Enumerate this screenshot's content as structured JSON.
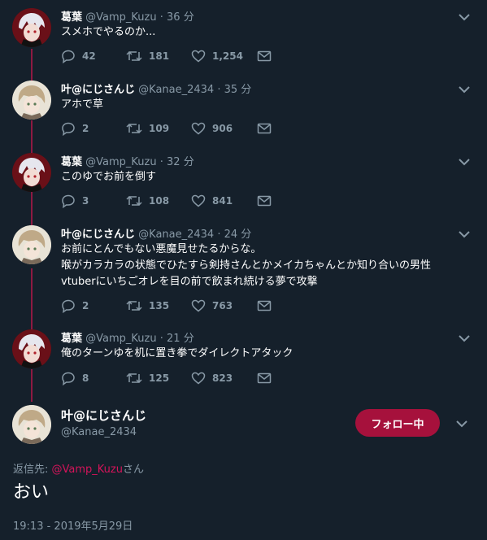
{
  "thread": [
    {
      "name": "葛葉",
      "handle": "@Vamp_Kuzu",
      "time": "36 分",
      "lines": [
        "スメホでやるのか..."
      ],
      "replies": "42",
      "retweets": "181",
      "likes": "1,254",
      "avatar": "kuzuha"
    },
    {
      "name": "叶@にじさんじ",
      "handle": "@Kanae_2434",
      "time": "35 分",
      "lines": [
        "アホで草"
      ],
      "replies": "2",
      "retweets": "109",
      "likes": "906",
      "avatar": "kanae"
    },
    {
      "name": "葛葉",
      "handle": "@Vamp_Kuzu",
      "time": "32 分",
      "lines": [
        "このゆでお前を倒す"
      ],
      "replies": "3",
      "retweets": "108",
      "likes": "841",
      "avatar": "kuzuha"
    },
    {
      "name": "叶@にじさんじ",
      "handle": "@Kanae_2434",
      "time": "24 分",
      "lines": [
        "お前にとんでもない悪魔見せたるからな。",
        "喉がカラカラの状態でひたすら剣持さんとかメイカちゃんとか知り合いの男性",
        "vtuberにいちごオレを目の前で飲まれ続ける夢で攻撃"
      ],
      "replies": "2",
      "retweets": "135",
      "likes": "763",
      "avatar": "kanae"
    },
    {
      "name": "葛葉",
      "handle": "@Vamp_Kuzu",
      "time": "21 分",
      "lines": [
        "俺のターンゆを机に置き拳でダイレクトアタック"
      ],
      "replies": "8",
      "retweets": "125",
      "likes": "823",
      "avatar": "kuzuha"
    }
  ],
  "main": {
    "name": "叶@にじさんじ",
    "handle": "@Kanae_2434",
    "follow_label": "フォロー中",
    "reply_prefix": "返信先: ",
    "reply_to": "@Vamp_Kuzu",
    "reply_suffix": "さん",
    "text": "おい",
    "timestamp": "19:13 - 2019年5月29日"
  },
  "colors": {
    "background": "#15202b",
    "muted": "#8899a6",
    "accent": "#a6113c",
    "thread_line": "#8e1a42"
  },
  "icons": [
    "reply-icon",
    "retweet-icon",
    "like-icon",
    "dm-icon",
    "chevron-down-icon"
  ]
}
